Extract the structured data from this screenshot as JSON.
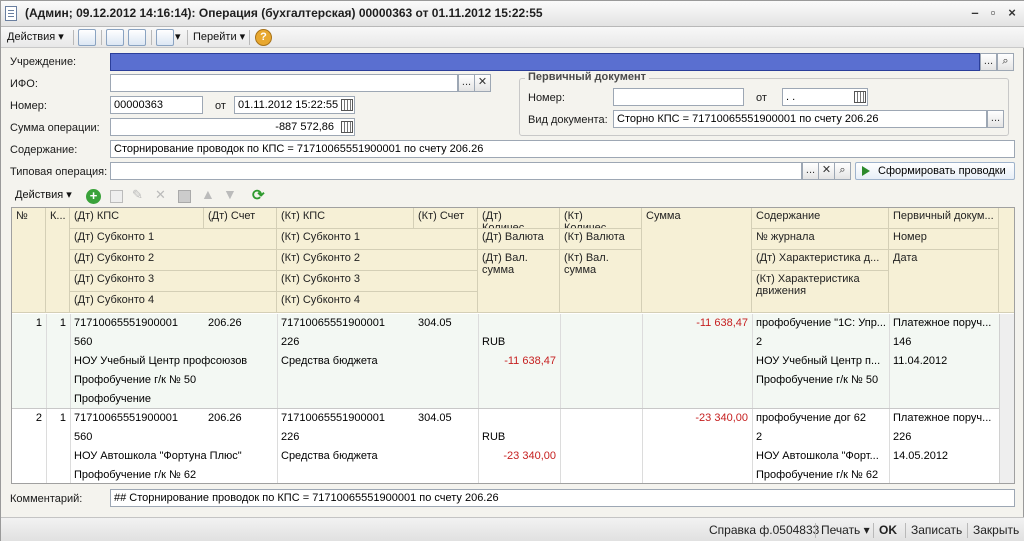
{
  "window": {
    "title": "(Админ; 09.12.2012 14:16:14): Операция (бухгалтерская) 00000363 от 01.11.2012 15:22:55"
  },
  "toolbar": {
    "actions": "Действия",
    "goto": "Перейти"
  },
  "form": {
    "institution_label": "Учреждение:",
    "ifo_label": "ИФО:",
    "number_label": "Номер:",
    "number_value": "00000363",
    "from_label": "от",
    "date_value": "01.11.2012 15:22:55",
    "sum_label": "Сумма операции:",
    "sum_value": "-887 572,86",
    "content_label": "Содержание:",
    "content_value": "Сторнирование проводок по КПС = 71710065551900001 по счету 206.26",
    "typical_label": "Типовая операция:",
    "generate_button": "Сформировать проводки",
    "comment_label": "Комментарий:",
    "comment_value": "## Сторнирование проводок по КПС = 71710065551900001 по счету 206.26"
  },
  "primary_doc": {
    "title": "Первичный документ",
    "number_label": "Номер:",
    "from_label": "от",
    "date_placeholder": " .  .",
    "type_label": "Вид документа:",
    "type_value": "Сторно КПС = 71710065551900001 по счету 206.26"
  },
  "table_toolbar": {
    "actions": "Действия"
  },
  "grid": {
    "headers": {
      "num": "№",
      "k": "К...",
      "dt_kps": "(Дт) КПС",
      "dt_account": "(Дт) Счет",
      "kt_kps": "(Кт) КПС",
      "kt_account": "(Кт) Счет",
      "dt_qty": "(Дт) Количес...",
      "kt_qty": "(Кт) Количес...",
      "sum": "Сумма",
      "content": "Содержание",
      "primary": "Первичный докум...",
      "dt_sub1": "(Дт) Субконто 1",
      "kt_sub1": "(Кт) Субконто 1",
      "dt_currency": "(Дт) Валюта",
      "kt_currency": "(Кт) Валюта",
      "journal": "№ журнала",
      "number": "Номер",
      "dt_sub2": "(Дт) Субконто 2",
      "kt_sub2": "(Кт) Субконто 2",
      "dt_val_sum": "(Дт) Вал. сумма",
      "kt_val_sum": "(Кт) Вал. сумма",
      "dt_char": "(Дт) Характеристика д...",
      "date": "Дата",
      "dt_sub3": "(Дт) Субконто 3",
      "kt_sub3": "(Кт) Субконто 3",
      "kt_char": "(Кт) Характеристика движения",
      "dt_sub4": "(Дт) Субконто 4",
      "kt_sub4": "(Кт) Субконто 4"
    },
    "rows": [
      {
        "num": "1",
        "k": "1",
        "dt_kps": "71710065551900001",
        "dt_account": "206.26",
        "kt_kps": "71710065551900001",
        "kt_account": "304.05",
        "sum": "-11 638,47",
        "content": "профобучение \"1С: Упр...",
        "primary": "Платежное поруч...",
        "dt_sub1": "560",
        "kt_sub1": "226",
        "dt_currency": "RUB",
        "journal": "2",
        "number": "146",
        "dt_sub2": "НОУ Учебный Центр профсоюзов",
        "kt_sub2": "Средства бюджета",
        "dt_val_sum": "-11 638,47",
        "dt_char": "НОУ Учебный Центр п...",
        "date": "11.04.2012",
        "dt_sub3": "Профобучение г/к № 50",
        "kt_char": "Профобучение г/к № 50",
        "dt_sub4": "Профобучение"
      },
      {
        "num": "2",
        "k": "1",
        "dt_kps": "71710065551900001",
        "dt_account": "206.26",
        "kt_kps": "71710065551900001",
        "kt_account": "304.05",
        "sum": "-23 340,00",
        "content": "профобучение  дог 62",
        "primary": "Платежное поруч...",
        "dt_sub1": "560",
        "kt_sub1": "226",
        "dt_currency": "RUB",
        "journal": "2",
        "number": "226",
        "dt_sub2": "НОУ Автошкола \"Фортуна Плюс\"",
        "kt_sub2": "Средства бюджета",
        "dt_val_sum": "-23 340,00",
        "dt_char": "НОУ Автошкола \"Форт...",
        "date": "14.05.2012",
        "dt_sub3": "Профобучение г/к № 62",
        "kt_char": "Профобучение г/к № 62"
      }
    ]
  },
  "statusbar": {
    "report": "Справка ф.0504833",
    "print": "Печать",
    "ok": "OK",
    "save": "Записать",
    "close": "Закрыть"
  },
  "colors": {
    "selected_field": "#5a6fd0",
    "negative": "#c62020",
    "header_bg": "#f6f0d6"
  }
}
